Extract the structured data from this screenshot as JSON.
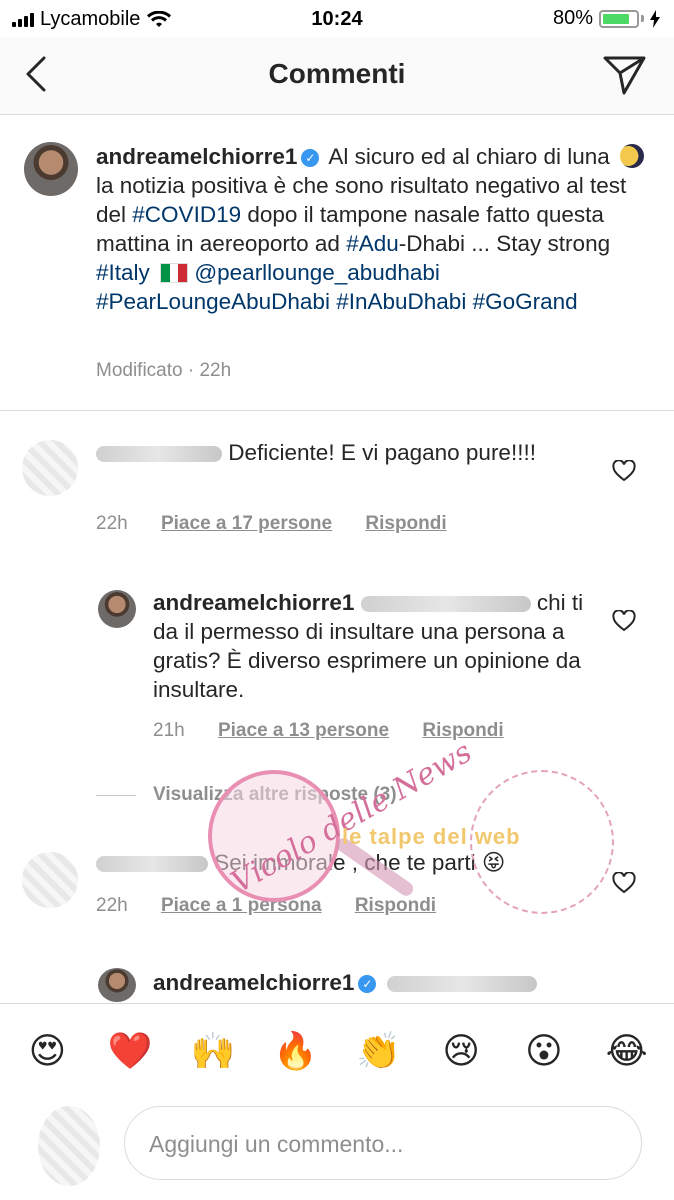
{
  "status_bar": {
    "carrier": "Lycamobile",
    "time": "10:24",
    "battery_percent": "80%",
    "battery_level": 0.8
  },
  "nav": {
    "title": "Commenti"
  },
  "caption": {
    "username": "andreamelchiorre1",
    "text_1": "Al sicuro ed al chiaro di luna",
    "text_2": "la notizia positiva è che sono risultato negativo al test del",
    "tag_covid": "#COVID19",
    "text_3": "dopo il tampone nasale fatto questa mattina in aereoporto ad",
    "tag_adu": "#Adu",
    "text_4": "-Dhabi ... Stay strong",
    "tag_italy": "#Italy",
    "mention": "@pearllounge_abudhabi",
    "tag_pear": "#PearLoungeAbuDhabi",
    "tag_inabu": "#InAbuDhabi",
    "tag_gogrand": "#GoGrand",
    "meta": "Modificato · 22h"
  },
  "comments": [
    {
      "text": "Deficiente! E vi pagano pure!!!!",
      "time": "22h",
      "likes": "Piace a 17 persone",
      "reply": "Rispondi"
    },
    {
      "username": "andreamelchiorre1",
      "text": "chi ti da il permesso di insultare una persona a gratis? È diverso esprimere un opinione da insultare.",
      "time": "21h",
      "likes": "Piace a 13 persone",
      "reply": "Rispondi"
    },
    {
      "text": "Sei immorale , che te parti 😝",
      "time": "22h",
      "likes": "Piace a 1 persona",
      "reply": "Rispondi"
    },
    {
      "username": "andreamelchiorre1"
    }
  ],
  "view_more": "Visualizza altre risposte (3)",
  "watermark": {
    "circle_text": "Vicolo delle News",
    "banner_text": "le talpe del web"
  },
  "emoji_bar": [
    "😍",
    "❤️",
    "🙌",
    "🔥",
    "👏",
    "😢",
    "😮",
    "😂"
  ],
  "composer": {
    "placeholder": "Aggiungi un commento..."
  }
}
